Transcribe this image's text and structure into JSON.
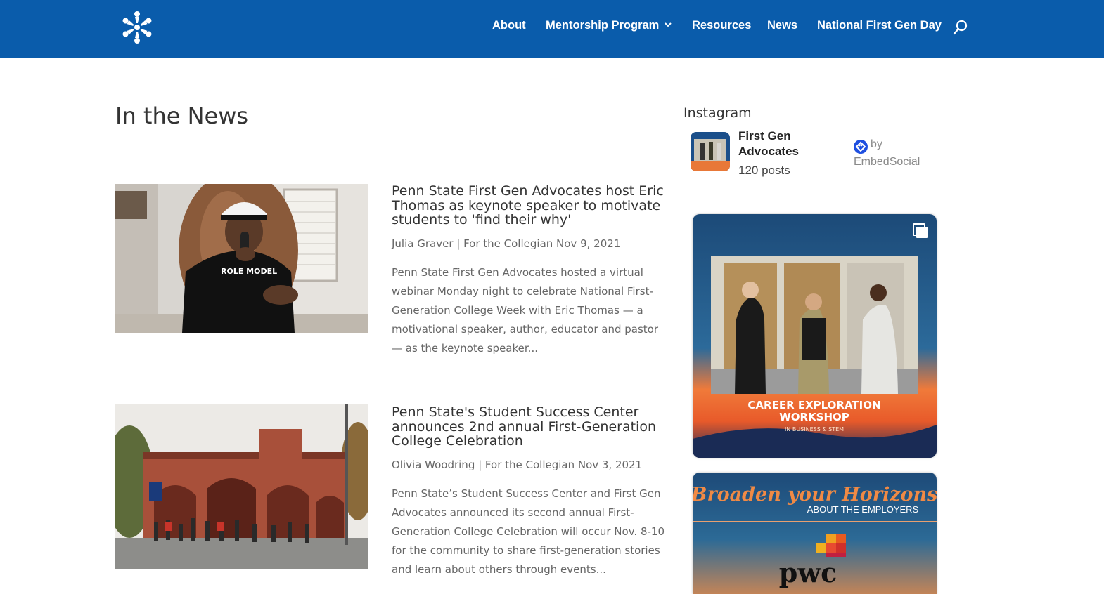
{
  "colors": {
    "header_bg": "#0a5cab",
    "nav_text": "#ffffff",
    "heading_text": "#333333",
    "body_text": "#666666",
    "embed_accent": "#1e4fe0",
    "workshop_orange": "#f07a3a",
    "horizons_orange": "#f08a45"
  },
  "header": {
    "logo_icon": "first-gen-advocates-star-logo",
    "nav": [
      {
        "label": "About"
      },
      {
        "label": "Mentorship Program",
        "has_dropdown": true
      },
      {
        "label": "Resources"
      },
      {
        "label": "News"
      },
      {
        "label": "National First Gen Day"
      }
    ],
    "search_icon": "search-icon"
  },
  "main": {
    "title": "In the News",
    "articles": [
      {
        "title": "Penn State First Gen Advocates host Eric Thomas as keynote speaker to motivate students to 'find their why'",
        "meta": "Julia Graver | For the Collegian Nov 9, 2021",
        "excerpt": "Penn State First Gen Advocates hosted a virtual webinar Monday night to celebrate National First-Generation College Week with Eric Thomas — a motivational speaker, author, educator and pastor — as the keynote speaker...",
        "image_shirt_text": "ROLE MODEL"
      },
      {
        "title": "Penn State's Student Success Center announces 2nd annual First-Generation College Celebration",
        "meta": "Olivia Woodring | For the Collegian Nov 3, 2021",
        "excerpt": "Penn State’s Student Success Center and First Gen Advocates announced its second annual First-Generation College Celebration will occur Nov. 8-10 for the community to share first-generation stories and learn about others through events..."
      }
    ]
  },
  "sidebar": {
    "heading": "Instagram",
    "account_name": "First Gen Advocates",
    "posts_count": "120 posts",
    "embed_by": "by",
    "embed_link": "EmbedSocial",
    "posts": [
      {
        "caption_line1": "CAREER EXPLORATION",
        "caption_line2": "WORKSHOP",
        "caption_line3": "IN BUSINESS & STEM",
        "carousel_icon": "multiple-images-icon"
      },
      {
        "script_text": "Broaden your Horizons",
        "subtitle": "ABOUT THE EMPLOYERS",
        "brand": "pwc"
      }
    ]
  }
}
